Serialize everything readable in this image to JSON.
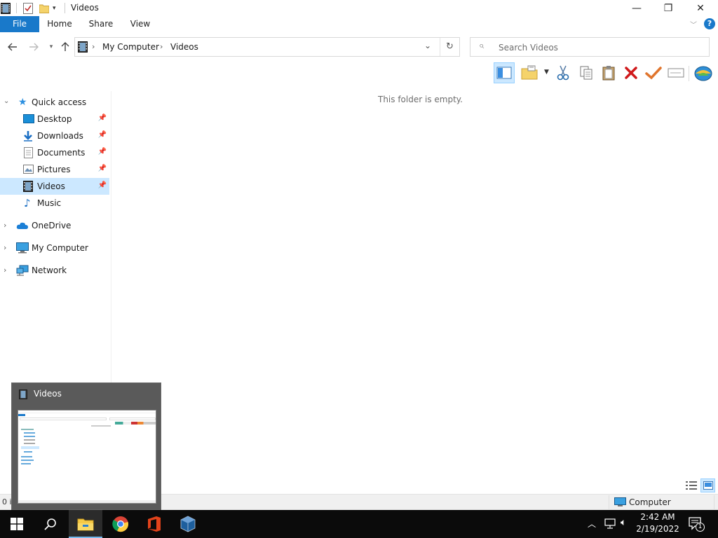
{
  "window": {
    "title": "Videos",
    "controls": {
      "minimize": "—",
      "maximize": "❐",
      "close": "✕"
    }
  },
  "ribbon": {
    "tabs": [
      "File",
      "Home",
      "Share",
      "View"
    ],
    "help": "?"
  },
  "address": {
    "path": [
      "My Computer",
      "Videos"
    ],
    "search_placeholder": "Search Videos"
  },
  "toolbar": {
    "buttons": [
      "view-pane",
      "new-folder",
      "cut",
      "copy",
      "paste",
      "delete",
      "check",
      "rename",
      "properties"
    ]
  },
  "navpane": {
    "quick_access": "Quick access",
    "quick_items": [
      {
        "label": "Desktop",
        "pinned": true,
        "icon": "desktop-icon"
      },
      {
        "label": "Downloads",
        "pinned": true,
        "icon": "downloads-icon"
      },
      {
        "label": "Documents",
        "pinned": true,
        "icon": "documents-icon"
      },
      {
        "label": "Pictures",
        "pinned": true,
        "icon": "pictures-icon"
      },
      {
        "label": "Videos",
        "pinned": true,
        "icon": "videos-icon",
        "selected": true
      },
      {
        "label": "Music",
        "pinned": false,
        "icon": "music-icon"
      }
    ],
    "roots": [
      {
        "label": "OneDrive",
        "icon": "onedrive-icon"
      },
      {
        "label": "My Computer",
        "icon": "computer-icon"
      },
      {
        "label": "Network",
        "icon": "network-icon"
      }
    ]
  },
  "content": {
    "empty_message": "This folder is empty."
  },
  "statusbar": {
    "items_text": "0 items",
    "location": "Computer"
  },
  "thumbnail": {
    "title": "Videos"
  },
  "taskbar": {
    "clock_time": "2:42 AM",
    "clock_date": "2/19/2022",
    "notification_count": "1"
  },
  "colors": {
    "accent": "#1979ca",
    "selection": "#cce8ff",
    "taskbar": "#0b0b0b"
  }
}
